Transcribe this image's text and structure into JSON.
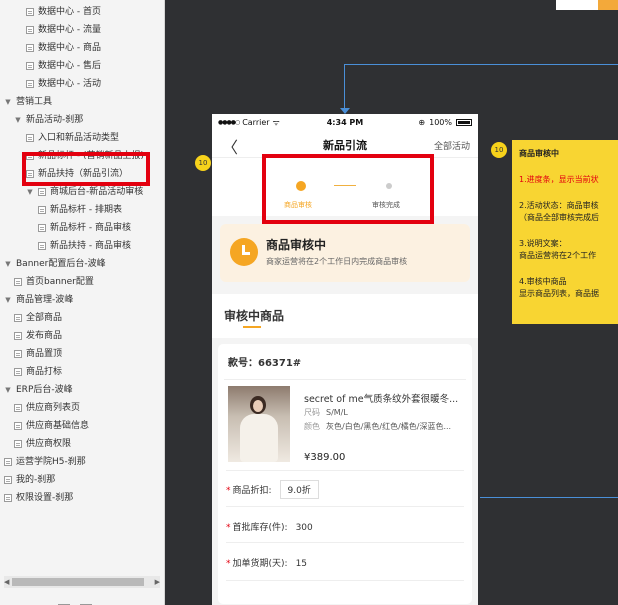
{
  "tree": {
    "items": [
      {
        "label": "数据中心 - 首页",
        "level": 2,
        "kind": "page"
      },
      {
        "label": "数据中心 - 流量",
        "level": 2,
        "kind": "page"
      },
      {
        "label": "数据中心 - 商品",
        "level": 2,
        "kind": "page"
      },
      {
        "label": "数据中心 - 售后",
        "level": 2,
        "kind": "page"
      },
      {
        "label": "数据中心 - 活动",
        "level": 2,
        "kind": "page"
      },
      {
        "label": "营销工具",
        "level": 0,
        "kind": "folder"
      },
      {
        "label": "新品活动-刹那",
        "level": 1,
        "kind": "folder"
      },
      {
        "label": "入口和新品活动类型",
        "level": 2,
        "kind": "page"
      },
      {
        "label": "新品标杆 - (营销新品上报)",
        "level": 2,
        "kind": "page"
      },
      {
        "label": "新品扶持（新品引流）",
        "level": 2,
        "kind": "page"
      },
      {
        "label": "商城后台-新品活动审核",
        "level": 2,
        "kind": "folder"
      },
      {
        "label": "新品标杆 - 排期表",
        "level": 3,
        "kind": "page"
      },
      {
        "label": "新品标杆 - 商品审核",
        "level": 3,
        "kind": "page"
      },
      {
        "label": "新品扶持 - 商品审核",
        "level": 3,
        "kind": "page"
      },
      {
        "label": "Banner配置后台-波峰",
        "level": 0,
        "kind": "folder"
      },
      {
        "label": "首页banner配置",
        "level": 1,
        "kind": "page"
      },
      {
        "label": "商品管理-波峰",
        "level": 0,
        "kind": "folder"
      },
      {
        "label": "全部商品",
        "level": 1,
        "kind": "page"
      },
      {
        "label": "发布商品",
        "level": 1,
        "kind": "page"
      },
      {
        "label": "商品置顶",
        "level": 1,
        "kind": "page"
      },
      {
        "label": "商品打标",
        "level": 1,
        "kind": "page"
      },
      {
        "label": "ERP后台-波峰",
        "level": 0,
        "kind": "folder"
      },
      {
        "label": "供应商列表页",
        "level": 1,
        "kind": "page"
      },
      {
        "label": "供应商基础信息",
        "level": 1,
        "kind": "page"
      },
      {
        "label": "供应商权限",
        "level": 1,
        "kind": "page"
      },
      {
        "label": "运营学院H5-刹那",
        "level": 0,
        "kind": "page"
      },
      {
        "label": "我的-刹那",
        "level": 0,
        "kind": "page"
      },
      {
        "label": "权限设置-刹那",
        "level": 0,
        "kind": "page"
      }
    ],
    "scroll_left": "◀",
    "scroll_right": "▶"
  },
  "phone": {
    "status": {
      "signal": "●●●●○",
      "carrier": "Carrier",
      "wifi": "ᯤ",
      "time": "4:34 PM",
      "alarm": "⊕",
      "battery_pct": "100%"
    },
    "nav": {
      "back": "〈",
      "title": "新品引流",
      "right": "全部活动"
    },
    "steps": {
      "step1": "商品审核",
      "step2": "审核完成"
    },
    "banner": {
      "title": "商品审核中",
      "subtitle": "商家运营将在2个工作日内完成商品审核"
    },
    "section_title": "审核中商品",
    "card": {
      "number_label": "款号：66371#",
      "product_name": "secret of me气质条纹外套很暖冬...",
      "size_label": "尺码",
      "size_value": "S/M/L",
      "color_label": "颜色",
      "color_value": "灰色/白色/黑色/红色/橘色/深蓝色...",
      "price": "¥389.00",
      "discount_label": "商品折扣:",
      "discount_value": "9.0折",
      "stock_label": "首批库存(件):",
      "stock_value": "300",
      "lead_label": "加单货期(天):",
      "lead_value": "15"
    }
  },
  "annotations": {
    "badge_left": "10",
    "badge_right": "10",
    "note_lines": [
      {
        "text": "商品审核中",
        "style": "bold"
      },
      {
        "text": "1.进度条，显示当前状",
        "style": "red"
      },
      {
        "text": "2.活动状态：商品审核",
        "style": ""
      },
      {
        "text": "（商品全部审核完成后",
        "style": ""
      },
      {
        "text": "3.说明文案：",
        "style": ""
      },
      {
        "text": "商品运营将在2个工作",
        "style": ""
      },
      {
        "text": "4.审核中商品",
        "style": ""
      },
      {
        "text": "显示商品列表，商品据",
        "style": ""
      }
    ]
  },
  "colors": {
    "accent": "#f5a623",
    "highlight": "#e3000f",
    "note": "#f8d532",
    "connector": "#4a8fd8"
  }
}
